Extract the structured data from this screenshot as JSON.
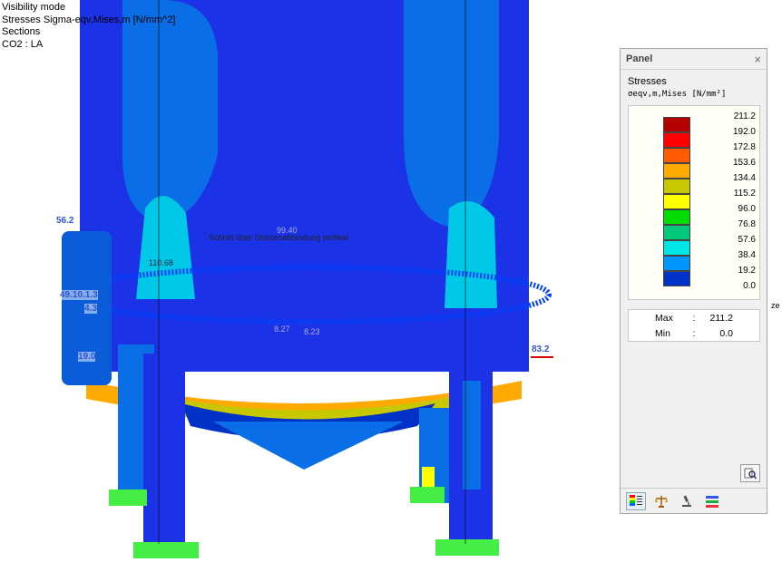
{
  "info": {
    "line1": "Visibility mode",
    "line2": "Stresses Sigma-eqv,Mises,m [N/mm^2]",
    "line3": "Sections",
    "line4": "CO2 : LA"
  },
  "model_labels": {
    "left_top": "56.2",
    "left_mid": "49.10.1.3",
    "left_mid2": "4.3",
    "left_low": "19.0",
    "right_edge": "83.2",
    "section_name": "Schnitt über Stützenabbindung vertikal",
    "section_value": "99.40",
    "val_a": "110.68",
    "val_b": "8.27",
    "val_c": "8.23",
    "clipped_label": "ze"
  },
  "panel": {
    "title": "Panel",
    "close": "×",
    "stress_title": "Stresses",
    "stress_sub": "σeqv,m,Mises [N/mm²]",
    "legend": [
      {
        "value": "211.2",
        "color": "#b40000"
      },
      {
        "value": "192.0",
        "color": "#ff0000"
      },
      {
        "value": "172.8",
        "color": "#ff5a00"
      },
      {
        "value": "153.6",
        "color": "#ffaa00"
      },
      {
        "value": "134.4",
        "color": "#c8c800"
      },
      {
        "value": "115.2",
        "color": "#ffff00"
      },
      {
        "value": "96.0",
        "color": "#00dc00"
      },
      {
        "value": "76.8",
        "color": "#00c878"
      },
      {
        "value": "57.6",
        "color": "#00e6e6"
      },
      {
        "value": "38.4",
        "color": "#0096ff"
      },
      {
        "value": "19.2",
        "color": "#0032c8"
      },
      {
        "value": "0.0",
        "color": ""
      }
    ],
    "max_label": "Max",
    "max_value": "211.2",
    "min_label": "Min",
    "min_value": "0.0",
    "footer_icons": [
      "color-scale-icon",
      "balance-icon",
      "microscope-icon",
      "list-icon"
    ]
  }
}
